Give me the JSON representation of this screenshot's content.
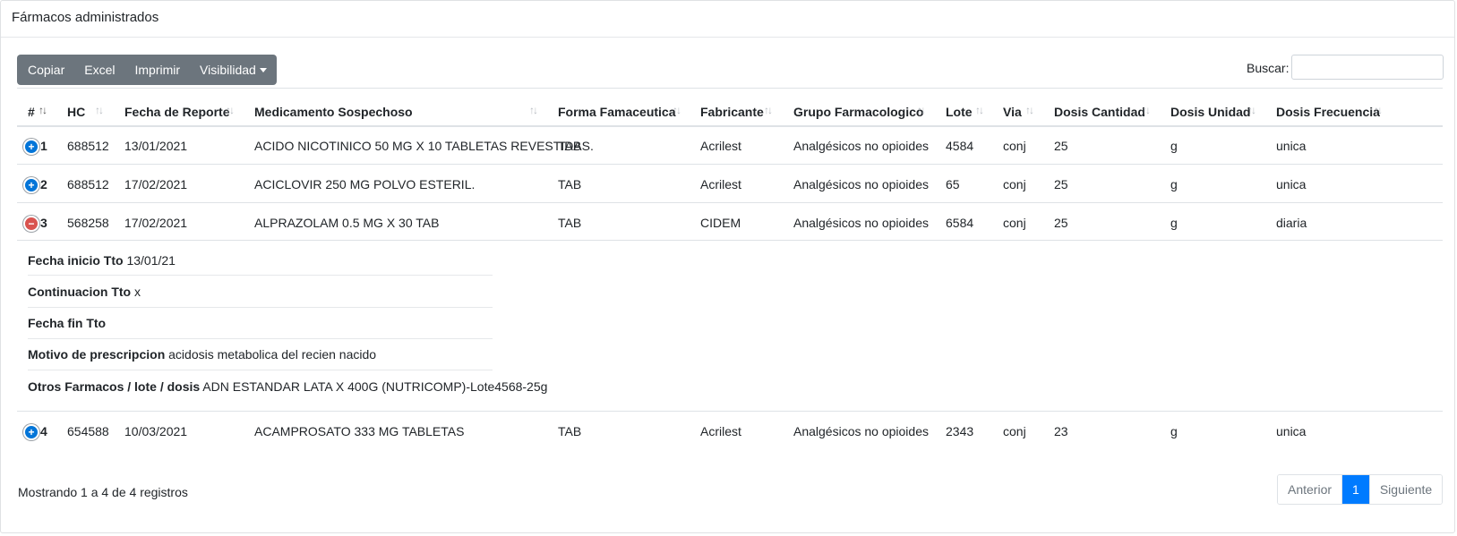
{
  "card": {
    "title": "Fármacos administrados"
  },
  "toolbar": {
    "copy_label": "Copiar",
    "excel_label": "Excel",
    "print_label": "Imprimir",
    "visibility_label": "Visibilidad"
  },
  "search": {
    "label": "Buscar:",
    "value": "",
    "placeholder": ""
  },
  "table": {
    "columns": [
      "#",
      "HC",
      "Fecha de Reporte",
      "Medicamento Sospechoso",
      "Forma Famaceutica",
      "Fabricante",
      "Grupo Farmacologico",
      "Lote",
      "Via",
      "Dosis Cantidad",
      "Dosis Unidad",
      "Dosis Frecuencia"
    ],
    "rows": [
      {
        "id": "1",
        "expanded": false,
        "hc": "688512",
        "fecha": "13/01/2021",
        "medicamento": "ACIDO NICOTINICO 50 MG X 10 TABLETAS REVESTIDAS.",
        "forma": "TAB",
        "fabricante": "Acrilest",
        "grupo": "Analgésicos no opioides",
        "lote": "4584",
        "via": "conj",
        "cantidad": "25",
        "unidad": "g",
        "frecuencia": "unica"
      },
      {
        "id": "2",
        "expanded": false,
        "hc": "688512",
        "fecha": "17/02/2021",
        "medicamento": "ACICLOVIR 250 MG POLVO ESTERIL.",
        "forma": "TAB",
        "fabricante": "Acrilest",
        "grupo": "Analgésicos no opioides",
        "lote": "65",
        "via": "conj",
        "cantidad": "25",
        "unidad": "g",
        "frecuencia": "unica"
      },
      {
        "id": "3",
        "expanded": true,
        "hc": "568258",
        "fecha": "17/02/2021",
        "medicamento": "ALPRAZOLAM 0.5 MG X 30 TAB",
        "forma": "TAB",
        "fabricante": "CIDEM",
        "grupo": "Analgésicos no opioides",
        "lote": "6584",
        "via": "conj",
        "cantidad": "25",
        "unidad": "g",
        "frecuencia": "diaria"
      },
      {
        "id": "4",
        "expanded": false,
        "hc": "654588",
        "fecha": "10/03/2021",
        "medicamento": "ACAMPROSATO 333 MG TABLETAS",
        "forma": "TAB",
        "fabricante": "Acrilest",
        "grupo": "Analgésicos no opioides",
        "lote": "2343",
        "via": "conj",
        "cantidad": "23",
        "unidad": "g",
        "frecuencia": "unica"
      }
    ]
  },
  "detail": {
    "items": [
      {
        "label": "Fecha inicio Tto",
        "value": "13/01/21"
      },
      {
        "label": "Continuacion Tto",
        "value": "x"
      },
      {
        "label": "Fecha fin Tto",
        "value": ""
      },
      {
        "label": "Motivo de prescripcion",
        "value": "acidosis metabolica del recien nacido"
      },
      {
        "label": "Otros Farmacos / lote / dosis",
        "value": "ADN ESTANDAR LATA X 400G (NUTRICOMP)-Lote4568-25g"
      }
    ]
  },
  "footer": {
    "info": "Mostrando 1 a 4 de 4 registros",
    "prev_label": "Anterior",
    "current_page": "1",
    "next_label": "Siguiente"
  },
  "icons": {
    "expand": "plus-circle-icon",
    "collapse": "minus-circle-icon",
    "sort": "sort-arrows-icon",
    "dropdown": "caret-down-icon"
  },
  "colors": {
    "toolbar_bg": "#6c757d",
    "expand_icon": "#0275d8",
    "collapse_icon": "#d9534f",
    "active_page": "#007bff"
  }
}
